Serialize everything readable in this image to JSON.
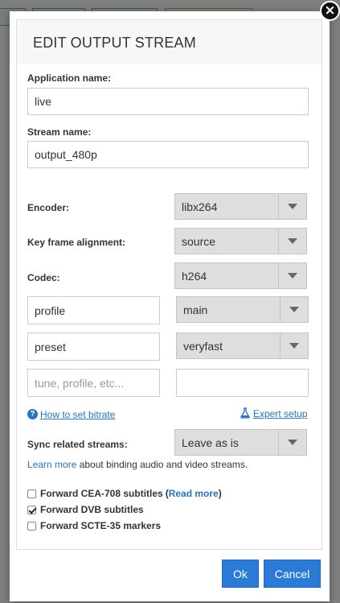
{
  "dialog": {
    "title": "EDIT OUTPUT STREAM",
    "close_symbol": "×"
  },
  "fields": {
    "application_name_label": "Application name:",
    "application_name_value": "live",
    "stream_name_label": "Stream name:",
    "stream_name_value": "output_480p"
  },
  "selects": {
    "encoder_label": "Encoder:",
    "encoder_value": "libx264",
    "keyframe_label": "Key frame alignment:",
    "keyframe_value": "source",
    "codec_label": "Codec:",
    "codec_value": "h264"
  },
  "params": {
    "profile_key": "profile",
    "profile_value": "main",
    "preset_key": "preset",
    "preset_value": "veryfast",
    "extra_key_placeholder": "tune, profile, etc...",
    "extra_value": ""
  },
  "links": {
    "bitrate_help": "How to set bitrate",
    "expert_setup": "Expert setup"
  },
  "sync": {
    "label": "Sync related streams:",
    "value": "Leave as is",
    "learn_more": "Learn more",
    "learn_more_suffix": " about binding audio and video streams."
  },
  "checkboxes": [
    {
      "label": "Forward CEA-708 subtitles",
      "checked": false,
      "read_more": "Read more"
    },
    {
      "label": "Forward DVB subtitles",
      "checked": true
    },
    {
      "label": "Forward SCTE-35 markers",
      "checked": false
    }
  ],
  "buttons": {
    "ok": "Ok",
    "cancel": "Cancel"
  },
  "colors": {
    "primary_button": "#2b7bd6",
    "link": "#2a73b9",
    "select_bg": "#dedede"
  }
}
